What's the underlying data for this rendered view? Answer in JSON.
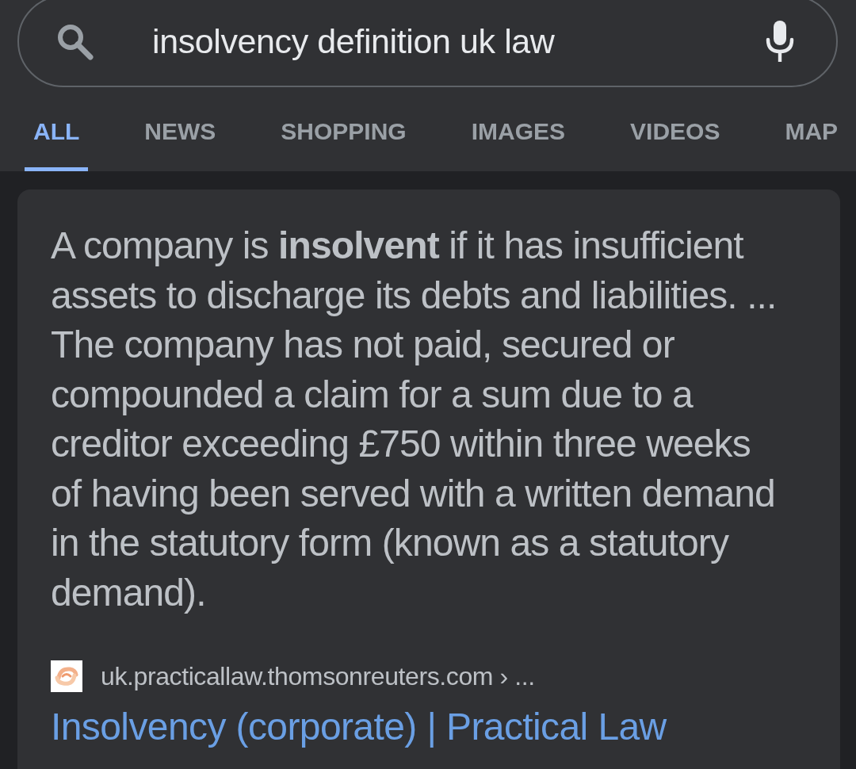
{
  "search": {
    "value": "insolvency definition uk law"
  },
  "tabs": [
    {
      "label": "ALL",
      "selected": true
    },
    {
      "label": "NEWS",
      "selected": false
    },
    {
      "label": "SHOPPING",
      "selected": false
    },
    {
      "label": "IMAGES",
      "selected": false
    },
    {
      "label": "VIDEOS",
      "selected": false
    },
    {
      "label": "MAP",
      "selected": false
    }
  ],
  "answer": {
    "text": "A company is **insolvent** if it has insufficient assets to discharge its debts and liabilities. ... The company has not paid, secured or compounded a claim for a sum due to a creditor exceeding £750 within three weeks of having been served with a written demand in the statutory form (known as a statutory demand).",
    "source": {
      "url": "uk.practicallaw.thomsonreuters.com › ...",
      "title": "Insolvency (corporate) | Practical Law"
    }
  }
}
